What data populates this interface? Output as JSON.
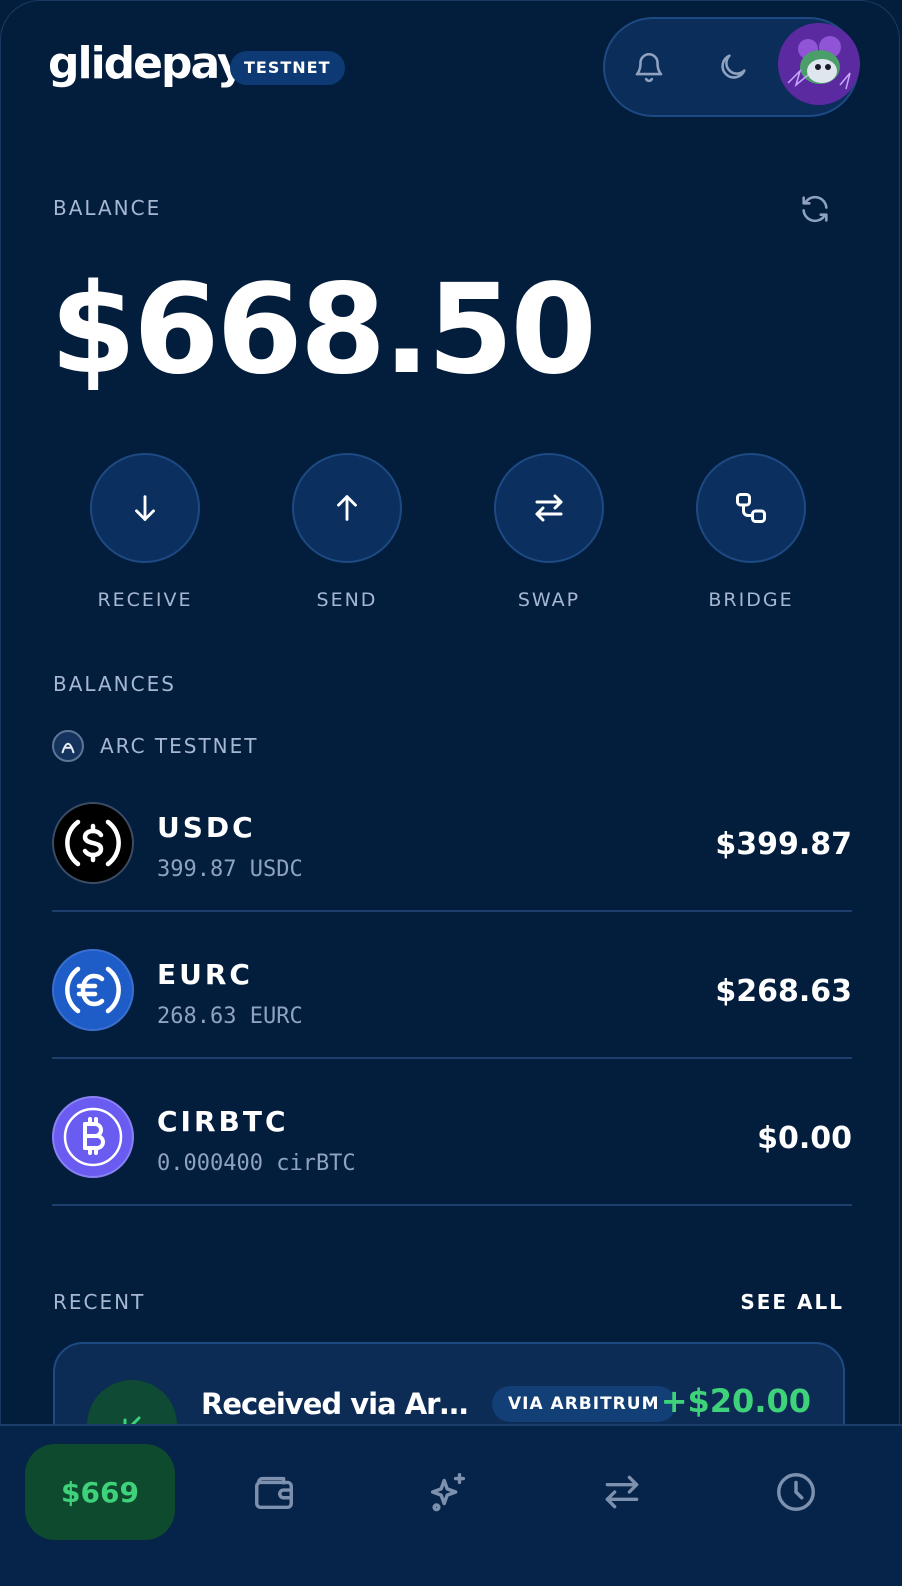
{
  "header": {
    "logo": "glidepay",
    "network_badge": "TESTNET",
    "icons": [
      "bell-icon",
      "moon-icon"
    ]
  },
  "balance": {
    "label": "BALANCE",
    "amount": "$668.50"
  },
  "actions": [
    {
      "label": "RECEIVE",
      "icon": "arrow-down-icon"
    },
    {
      "label": "SEND",
      "icon": "arrow-up-icon"
    },
    {
      "label": "SWAP",
      "icon": "swap-icon"
    },
    {
      "label": "BRIDGE",
      "icon": "bridge-icon"
    }
  ],
  "balances": {
    "label": "BALANCES",
    "chain": "ARC TESTNET",
    "tokens": [
      {
        "symbol": "USDC",
        "amount": "399.87 USDC",
        "value": "$399.87",
        "color": "#000000"
      },
      {
        "symbol": "EURC",
        "amount": "268.63 EURC",
        "value": "$268.63",
        "color": "#1e5cc8"
      },
      {
        "symbol": "CIRBTC",
        "amount": "0.000400 cirBTC",
        "value": "$0.00",
        "color": "#6a5cf0"
      }
    ]
  },
  "recent": {
    "label": "RECENT",
    "see_all": "SEE ALL",
    "items": [
      {
        "title": "Received via Arbit…",
        "badge": "VIA ARBITRUM",
        "amount": "+$20.00"
      }
    ]
  },
  "bottom_nav": {
    "balance_pill": "$669",
    "items": [
      "wallet-icon",
      "sparkles-icon",
      "swap-icon",
      "clock-icon"
    ]
  },
  "colors": {
    "background": "#031d3d",
    "accent_green": "#3ed37a",
    "muted_text": "#a6b8d1"
  }
}
